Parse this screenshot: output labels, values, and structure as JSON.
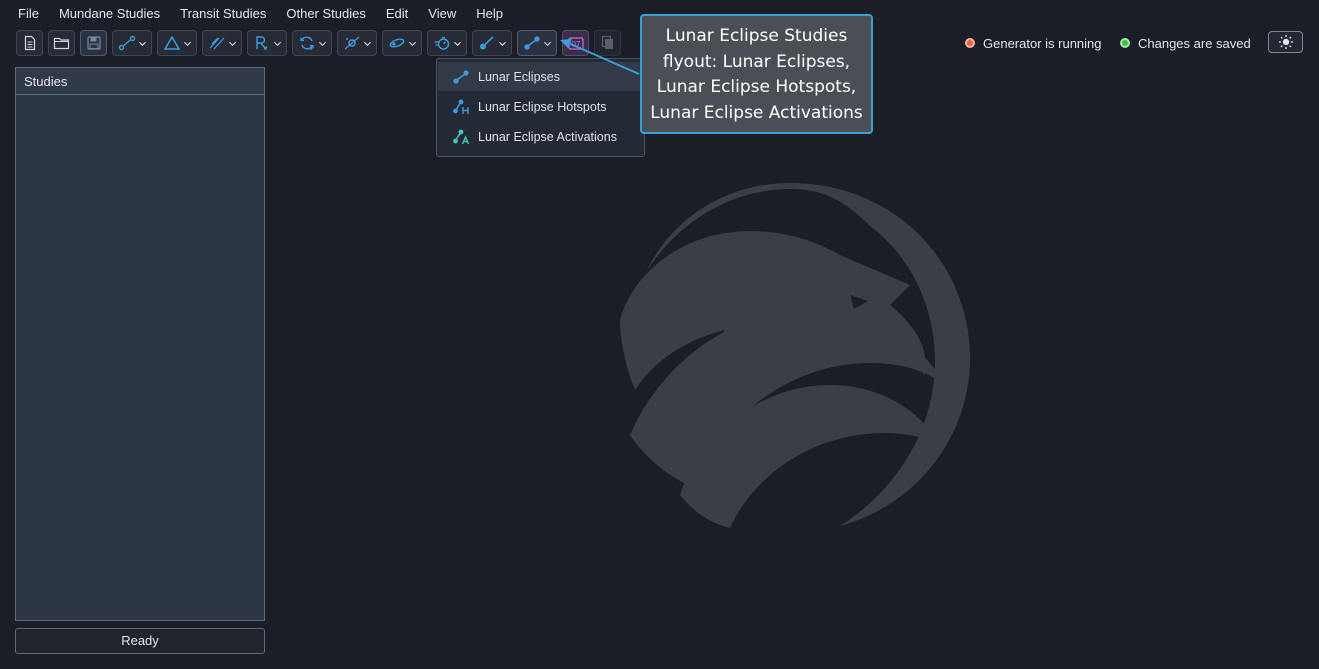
{
  "menu": [
    "File",
    "Mundane Studies",
    "Transit Studies",
    "Other Studies",
    "Edit",
    "View",
    "Help"
  ],
  "toolbar": {
    "buttons": [
      {
        "name": "new-file-button",
        "icon": "document-icon"
      },
      {
        "name": "open-file-button",
        "icon": "folder-icon"
      },
      {
        "name": "save-button",
        "icon": "disk-icon"
      },
      {
        "name": "aspects-dropdown",
        "icon": "aspect-icon"
      },
      {
        "name": "triangle-dropdown",
        "icon": "triangle-icon"
      },
      {
        "name": "parallels-dropdown",
        "icon": "parallel-icon"
      },
      {
        "name": "retrograde-dropdown",
        "icon": "retrograde-icon"
      },
      {
        "name": "cycles-dropdown",
        "icon": "cycle-icon"
      },
      {
        "name": "eclipse-dropdown",
        "icon": "eclipse-icon"
      },
      {
        "name": "ingress-dropdown",
        "icon": "ingress-icon"
      },
      {
        "name": "speed-dropdown",
        "icon": "speed-icon"
      },
      {
        "name": "solar-eclipse-dropdown",
        "icon": "solar-eclipse-icon"
      },
      {
        "name": "lunar-eclipse-dropdown",
        "icon": "lunar-eclipse-icon"
      },
      {
        "name": "calendar-button",
        "icon": "calendar-icon",
        "label": "07"
      },
      {
        "name": "copy-button",
        "icon": "copy-icon"
      }
    ]
  },
  "status": {
    "generator": "Generator is running",
    "saved": "Changes are saved",
    "generator_color": "#e8623a",
    "saved_color": "#3bc24a"
  },
  "studies": {
    "header": "Studies",
    "ready": "Ready"
  },
  "flyout": {
    "items": [
      {
        "label": "Lunar Eclipses",
        "icon": "lunar-eclipse-icon"
      },
      {
        "label": "Lunar Eclipse Hotspots",
        "icon": "lunar-eclipse-hotspots-icon"
      },
      {
        "label": "Lunar Eclipse Activations",
        "icon": "lunar-eclipse-activations-icon"
      }
    ]
  },
  "callout": {
    "lines": [
      "Lunar Eclipse Studies",
      "flyout: Lunar Eclipses,",
      "Lunar Eclipse Hotspots,",
      "Lunar Eclipse Activations"
    ]
  },
  "colors": {
    "accent": "#3aa0d8",
    "background": "#1b1e26",
    "panel": "#2b3543",
    "calendar": "#c86bd8"
  }
}
